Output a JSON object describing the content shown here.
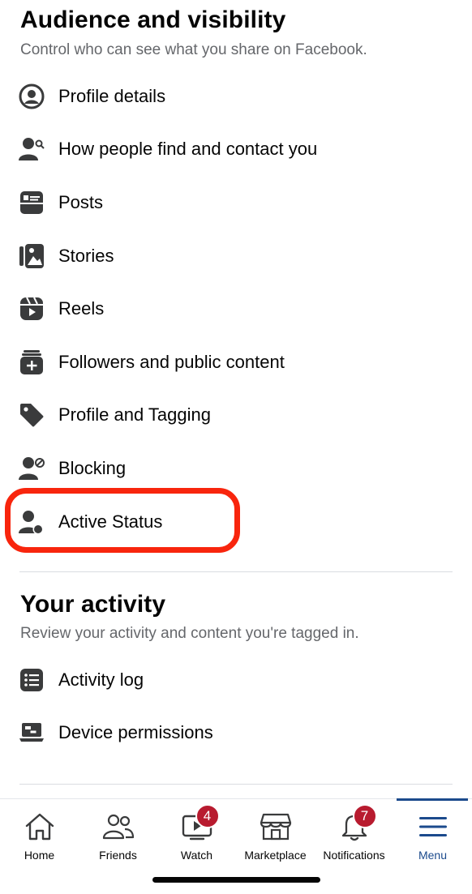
{
  "audience": {
    "title": "Audience and visibility",
    "subtitle": "Control who can see what you share on Facebook.",
    "items": [
      {
        "label": "Profile details",
        "icon": "profile-circle-icon"
      },
      {
        "label": "How people find and contact you",
        "icon": "person-search-icon"
      },
      {
        "label": "Posts",
        "icon": "posts-icon"
      },
      {
        "label": "Stories",
        "icon": "stories-icon"
      },
      {
        "label": "Reels",
        "icon": "reels-icon"
      },
      {
        "label": "Followers and public content",
        "icon": "followers-icon"
      },
      {
        "label": "Profile and Tagging",
        "icon": "tag-icon"
      },
      {
        "label": "Blocking",
        "icon": "block-user-icon"
      },
      {
        "label": "Active Status",
        "icon": "active-status-icon"
      }
    ]
  },
  "activity": {
    "title": "Your activity",
    "subtitle": "Review your activity and content you're tagged in.",
    "items": [
      {
        "label": "Activity log",
        "icon": "list-icon"
      },
      {
        "label": "Device permissions",
        "icon": "device-icon"
      }
    ]
  },
  "tabbar": {
    "tabs": [
      {
        "label": "Home",
        "icon": "home-icon"
      },
      {
        "label": "Friends",
        "icon": "friends-icon"
      },
      {
        "label": "Watch",
        "icon": "watch-icon",
        "badge": "4"
      },
      {
        "label": "Marketplace",
        "icon": "marketplace-icon"
      },
      {
        "label": "Notifications",
        "icon": "bell-icon",
        "badge": "7"
      },
      {
        "label": "Menu",
        "icon": "menu-icon"
      }
    ],
    "active_tab": "Menu"
  },
  "colors": {
    "icon": "#3a3b3c",
    "highlight": "#f8250d",
    "active": "#1b4a8c",
    "badge": "#b81b2f",
    "subtitle": "#65676b"
  }
}
